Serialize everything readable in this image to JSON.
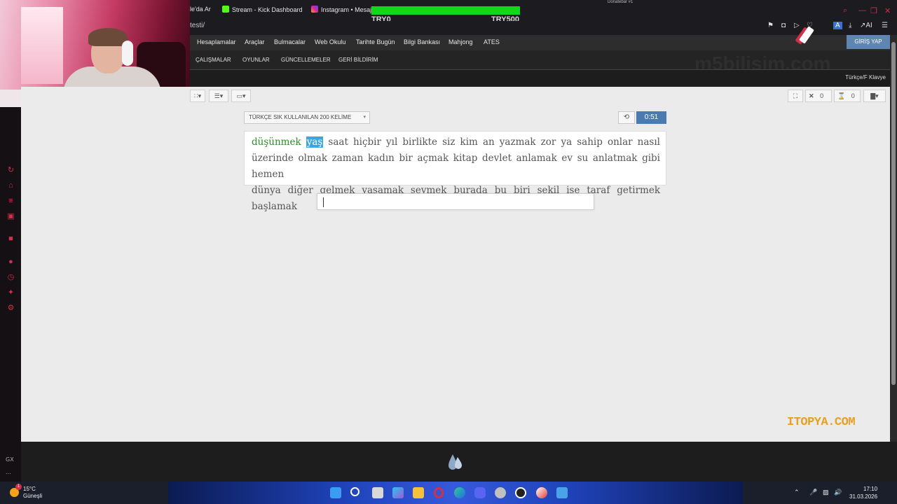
{
  "browser": {
    "tabs": [
      {
        "label": "le'da Ar",
        "icon": "page-icon"
      },
      {
        "label": "Stream - Kick Dashboard",
        "icon": "kick-icon"
      },
      {
        "label": "Instagram • Mesaji",
        "icon": "instagram-icon"
      }
    ],
    "url": "testi/",
    "donation_title": "Donatebar #1",
    "donation_left": "TRY0",
    "donation_right": "TRY500"
  },
  "site": {
    "nav_primary": [
      "Hesaplamalar",
      "Araçlar",
      "Bulmacalar",
      "Web Okulu",
      "Tarihte Bugün",
      "Bilgi Bankası",
      "Mahjong",
      "ATES"
    ],
    "login_label": "GİRİŞ YAP",
    "nav_secondary": [
      "ÇALIŞMALAR",
      "OYUNLAR",
      "GÜNCELLEMELER",
      "GERİ BİLDİRİM"
    ],
    "watermark": "m5bilisim.com",
    "keyboard_layout": "Türkçe/F Klavye"
  },
  "test": {
    "word_list_select": "TÜRKÇE SIK KULLANILAN 200 KELİME",
    "timer": "0:51",
    "wrong_count": "0",
    "pending_count": "0",
    "done_words": [
      "düşünmek"
    ],
    "current_word": "yaş",
    "remaining_line1": "saat hiçbir yıl birlikte siz kim an yazmak zor ya sahip onlar nasıl",
    "line2": "üzerinde olmak zaman kadın bir açmak kitap devlet anlamak ev su anlatmak gibi hemen",
    "line3": "dünya diğer gelmek yaşamak sevmek burada bu biri şekil ise taraf getirmek başlamak",
    "input_value": ""
  },
  "overlay": {
    "sponsor": "ITOPYA.COM"
  },
  "sidebar": {
    "gx_label": "GX",
    "more_label": "..."
  },
  "taskbar": {
    "weather_temp": "15°C",
    "weather_desc": "Güneşli",
    "time": "17:10",
    "date": "31.03.2026",
    "badge": "1"
  },
  "colors": {
    "accent_red": "#d0304a",
    "donation_green": "#10d81a",
    "timer_blue": "#4a7bb0",
    "correct_green": "#2e8b2e",
    "current_highlight": "#3da6dd",
    "sponsor_orange": "#e8a020"
  }
}
